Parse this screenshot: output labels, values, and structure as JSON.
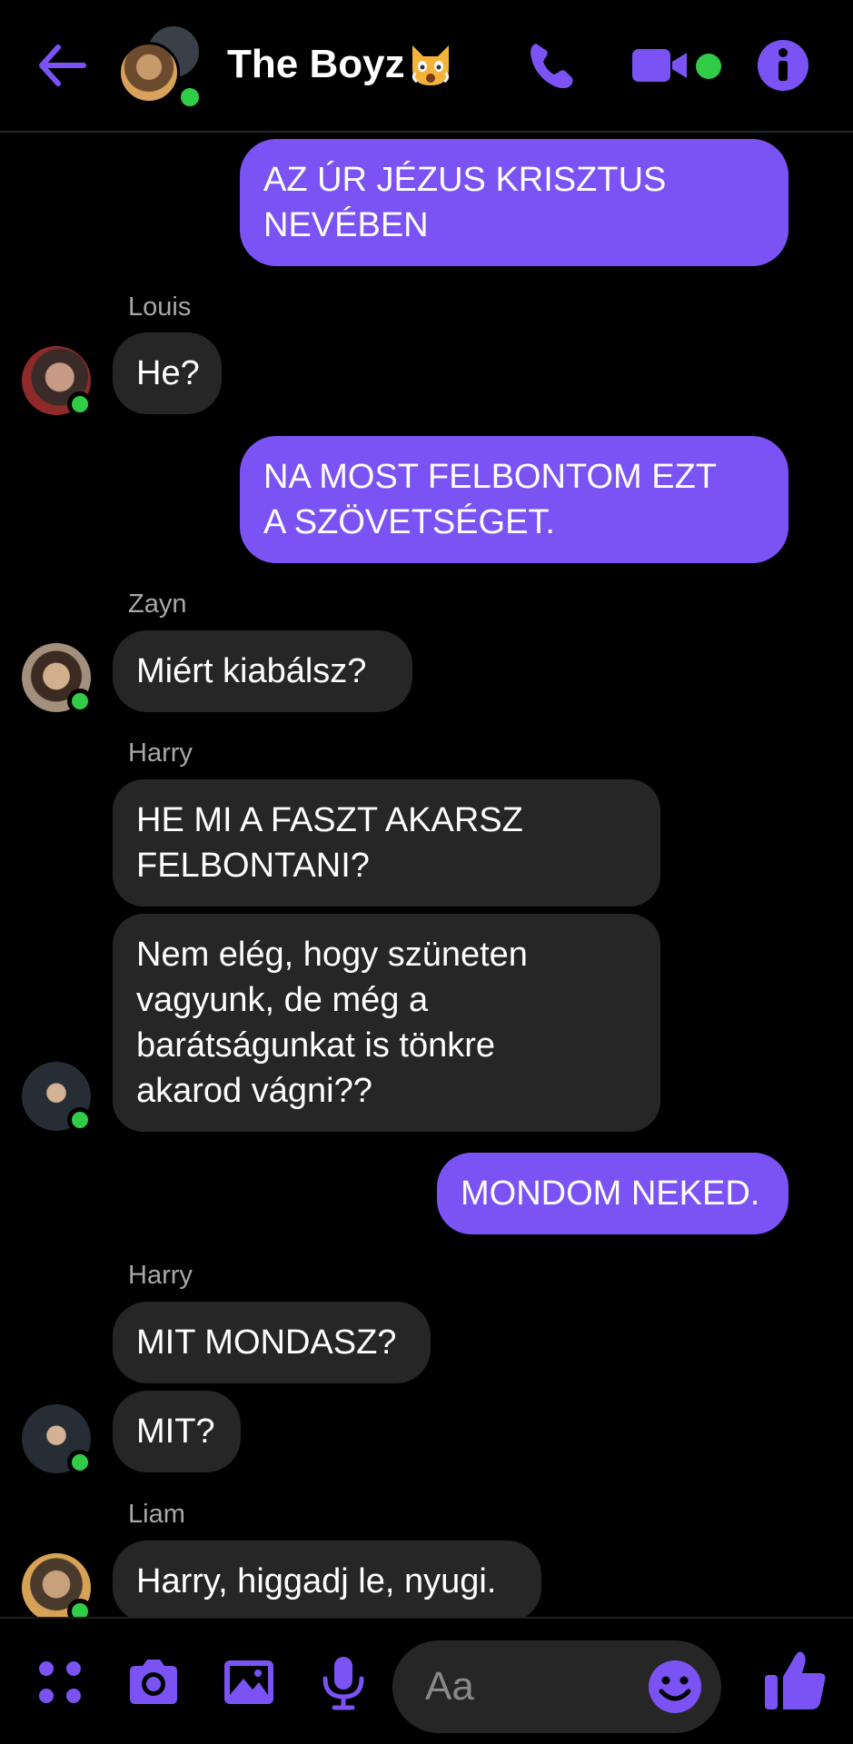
{
  "header": {
    "title": "The Boyz",
    "title_emoji": "weary-cat-emoji",
    "icons": [
      "back-arrow-icon",
      "phone-icon",
      "video-camera-icon",
      "info-icon"
    ],
    "accent_color": "#7b53f5",
    "online_color": "#31cc46"
  },
  "messages": {
    "m1": {
      "direction": "outgoing",
      "line1": "AZ ÚR JÉZUS KRISZTUS",
      "line2": "NEVÉBEN"
    },
    "louis_name": "Louis",
    "m2": {
      "direction": "incoming",
      "text": "He?"
    },
    "m3": {
      "direction": "outgoing",
      "line1": "NA MOST FELBONTOM EZT",
      "line2": "A SZÖVETSÉGET."
    },
    "zayn_name": "Zayn",
    "m4": {
      "direction": "incoming",
      "text": "Miért kiabálsz?"
    },
    "harry_name_1": "Harry",
    "m5": {
      "direction": "incoming",
      "line1": "HE MI A FASZT AKARSZ",
      "line2": "FELBONTANI?"
    },
    "m6": {
      "direction": "incoming",
      "line1": "Nem elég, hogy szüneten",
      "line2": "vagyunk, de még a",
      "line3": "barátságunkat is tönkre",
      "line4": "akarod vágni??"
    },
    "m7": {
      "direction": "outgoing",
      "text": "MONDOM NEKED."
    },
    "harry_name_2": "Harry",
    "m8": {
      "direction": "incoming",
      "text": "MIT MONDASZ?"
    },
    "m9": {
      "direction": "incoming",
      "text": "MIT?"
    },
    "liam_name": "Liam",
    "m10": {
      "direction": "incoming",
      "text": "Harry, higgadj le, nyugi."
    }
  },
  "composer": {
    "placeholder": "Aa",
    "icons": [
      "apps-icon",
      "camera-icon",
      "gallery-icon",
      "microphone-icon",
      "emoji-icon",
      "thumbs-up-icon"
    ]
  }
}
